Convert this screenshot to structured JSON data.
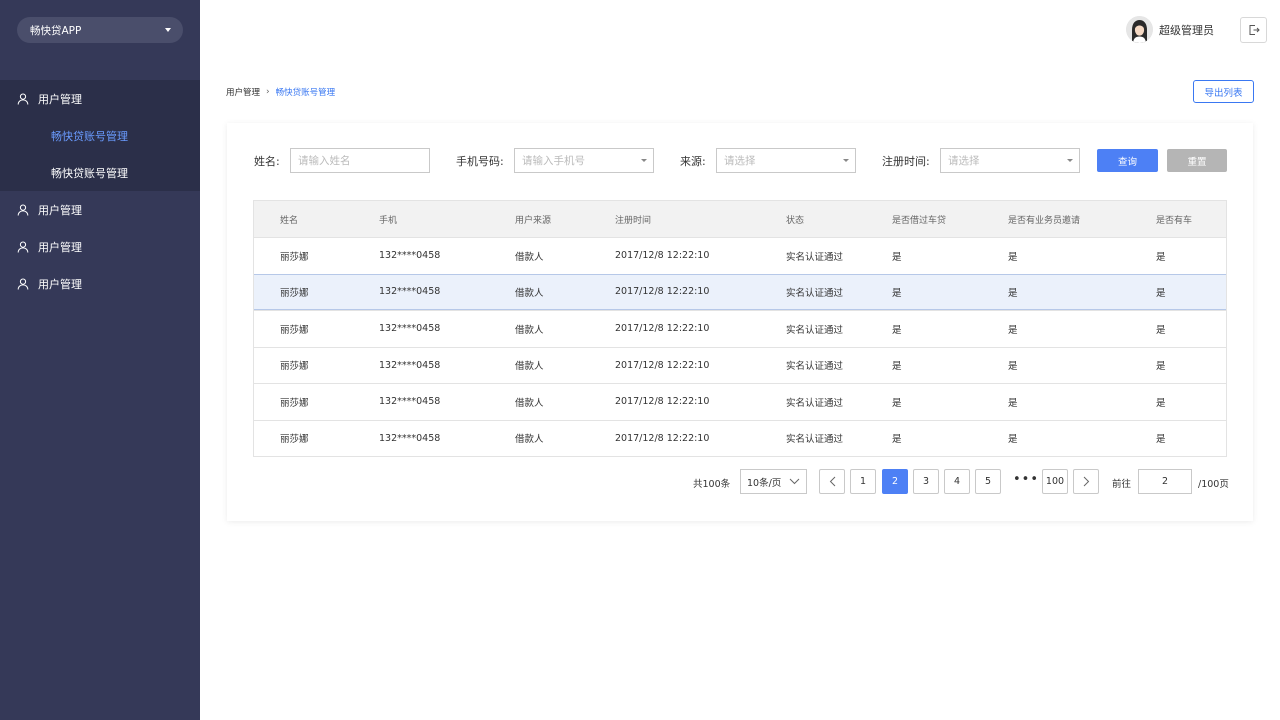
{
  "sidebar": {
    "app_name": "畅快贷APP",
    "groups": [
      {
        "label": "用户管理",
        "children": [
          "畅快贷账号管理",
          "畅快贷账号管理"
        ]
      },
      {
        "label": "用户管理"
      },
      {
        "label": "用户管理"
      },
      {
        "label": "用户管理"
      }
    ]
  },
  "header": {
    "username": "超级管理员"
  },
  "breadcrumb": [
    "用户管理",
    "畅快贷账号管理"
  ],
  "export_label": "导出列表",
  "filters": {
    "name_label": "姓名:",
    "name_placeholder": "请输入姓名",
    "phone_label": "手机号码:",
    "phone_placeholder": "请输入手机号",
    "source_label": "来源:",
    "source_placeholder": "请选择",
    "regtime_label": "注册时间:",
    "regtime_placeholder": "请选择",
    "query_label": "查询",
    "reset_label": "重置"
  },
  "table": {
    "columns": [
      "姓名",
      "手机",
      "用户来源",
      "注册时间",
      "状态",
      "是否借过车贷",
      "是否有业务员邀请",
      "是否有车"
    ],
    "rows": [
      [
        "丽莎娜",
        "132****0458",
        "借款人",
        "2017/12/8  12:22:10",
        "实名认证通过",
        "是",
        "是",
        "是"
      ],
      [
        "丽莎娜",
        "132****0458",
        "借款人",
        "2017/12/8  12:22:10",
        "实名认证通过",
        "是",
        "是",
        "是"
      ],
      [
        "丽莎娜",
        "132****0458",
        "借款人",
        "2017/12/8  12:22:10",
        "实名认证通过",
        "是",
        "是",
        "是"
      ],
      [
        "丽莎娜",
        "132****0458",
        "借款人",
        "2017/12/8  12:22:10",
        "实名认证通过",
        "是",
        "是",
        "是"
      ],
      [
        "丽莎娜",
        "132****0458",
        "借款人",
        "2017/12/8  12:22:10",
        "实名认证通过",
        "是",
        "是",
        "是"
      ],
      [
        "丽莎娜",
        "132****0458",
        "借款人",
        "2017/12/8  12:22:10",
        "实名认证通过",
        "是",
        "是",
        "是"
      ]
    ],
    "highlighted_row": 1
  },
  "pagination": {
    "total": "共100条",
    "page_size": "10条/页",
    "pages": [
      "1",
      "2",
      "3",
      "4",
      "5"
    ],
    "current": "2",
    "ellipsis": "•••",
    "last": "100",
    "goto_label": "前往",
    "goto_value": "2",
    "pages_total": "/100页"
  },
  "colors": {
    "sidebar_bg": "#353958",
    "accent": "#4d80f5",
    "active_menu": "#6a9bff"
  }
}
